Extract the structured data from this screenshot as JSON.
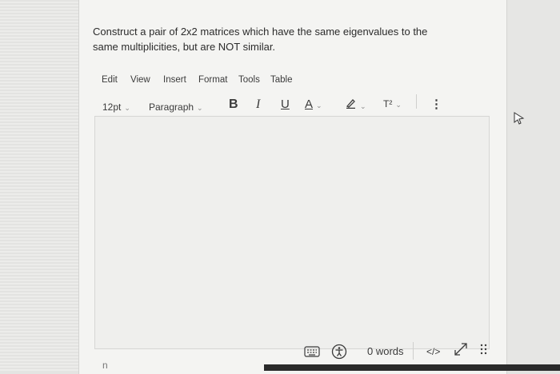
{
  "question": {
    "line1": "Construct a pair of 2x2 matrices which have the same eigenvalues to the",
    "line2": "same multiplicities, but are NOT similar."
  },
  "menu": [
    "Edit",
    "View",
    "Insert",
    "Format",
    "Tools",
    "Table"
  ],
  "toolbar": {
    "font_size": "12pt",
    "block_format": "Paragraph",
    "bold": "B",
    "italic": "I",
    "underline": "U",
    "text_color": "A",
    "superscript": "T²",
    "more": "⋮"
  },
  "footer": {
    "word_count": "0 words",
    "html_toggle": "</>"
  },
  "stray_char": "n"
}
